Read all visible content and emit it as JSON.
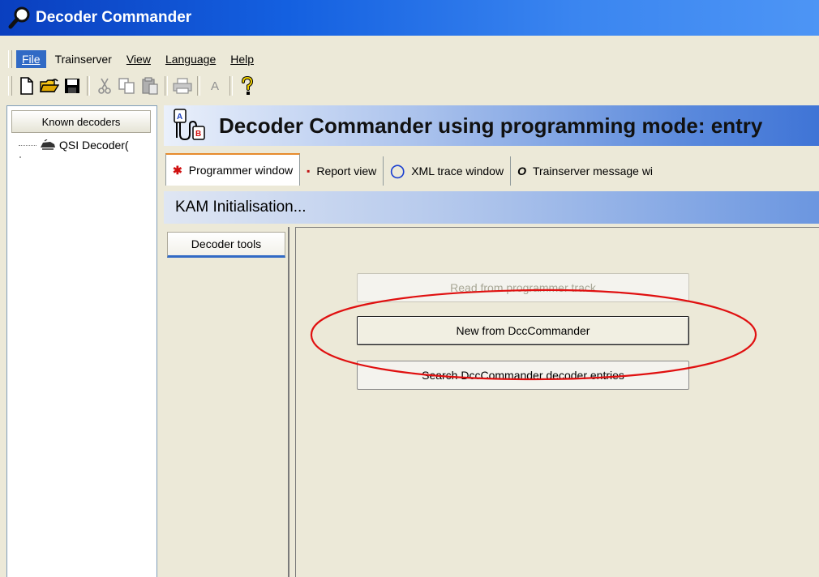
{
  "window": {
    "title": "Decoder Commander",
    "icon": "magnifier-icon"
  },
  "menu": [
    {
      "label": "File",
      "active": true
    },
    {
      "label": "Trainserver",
      "active": false
    },
    {
      "label": "View",
      "active": false
    },
    {
      "label": "Language",
      "active": false
    },
    {
      "label": "Help",
      "active": false
    }
  ],
  "toolbar": {
    "icons": [
      "new-document-icon",
      "open-folder-icon",
      "save-icon",
      "cut-icon",
      "copy-icon",
      "paste-icon",
      "print-icon",
      "font-icon",
      "help-icon"
    ],
    "font_button_label": "A"
  },
  "left_panel": {
    "header": "Known decoders",
    "tree_items": [
      {
        "label": "QSI Decoder(",
        "icon": "locomotive-icon"
      }
    ]
  },
  "main": {
    "title": "Decoder Commander using programming mode:  entry",
    "tabs": [
      {
        "label": "Programmer window",
        "icon": "programmer-icon",
        "active": true
      },
      {
        "label": "Report view",
        "icon": "report-icon",
        "active": false
      },
      {
        "label": "XML trace window",
        "icon": "xml-trace-icon",
        "active": false
      },
      {
        "label": "Trainserver message wi",
        "icon": "message-icon",
        "active": false
      }
    ],
    "section_title": "KAM Initialisation...",
    "tool_tab": "Decoder tools",
    "buttons": {
      "read": {
        "label": "Read from programmer track",
        "enabled": false
      },
      "new": {
        "label": "New from DccCommander",
        "enabled": true
      },
      "search": {
        "label": "Search DccCommander decoder entries",
        "enabled": true
      }
    }
  },
  "colors": {
    "title_blue": "#0a3fbf",
    "highlight": "#316ac5",
    "annotation_red": "#e01010",
    "tab_accent": "#e68b2c"
  }
}
